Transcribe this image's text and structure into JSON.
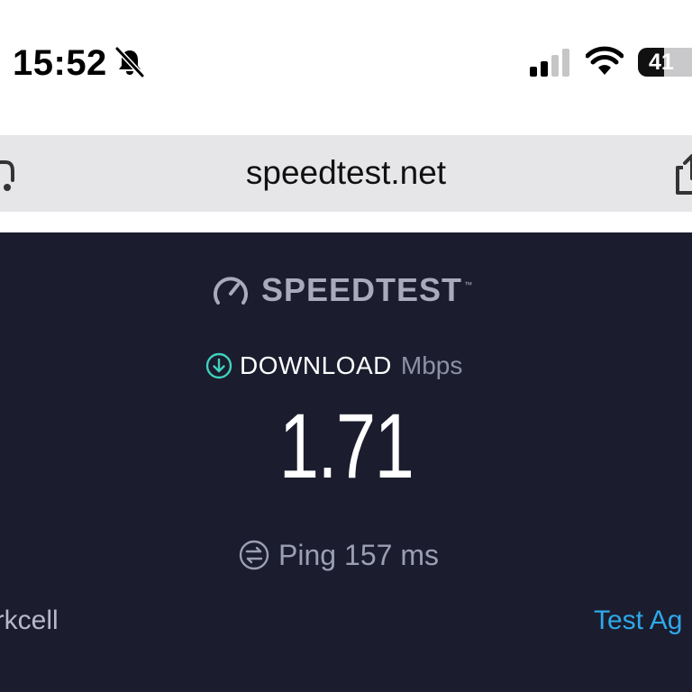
{
  "status_bar": {
    "time": "15:52",
    "silent_icon": "bell-slash-icon",
    "signal_icon": "cellular-signal-icon",
    "signal_bars_active": 2,
    "signal_bars_total": 4,
    "wifi_icon": "wifi-icon",
    "battery_level": "41",
    "battery_fraction": 0.41
  },
  "browser": {
    "url": "speedtest.net",
    "left_icon": "reader-icon",
    "right_icon": "share-icon"
  },
  "speedtest": {
    "brand": "SPEEDTEST",
    "brand_mark": "™",
    "brand_icon": "gauge-icon",
    "download_icon": "download-arrow-icon",
    "download_label": "DOWNLOAD",
    "download_unit": "Mbps",
    "download_value": "1.71",
    "ping_icon": "ping-icon",
    "ping_label": "Ping",
    "ping_value": "157 ms",
    "isp_name": "urkcell",
    "test_again": "Test Ag"
  },
  "colors": {
    "panel_background": "#1b1c2e",
    "url_bar_background": "#e6e6e9",
    "download_accent": "#3fd1bd",
    "link": "#2ea8e8"
  }
}
